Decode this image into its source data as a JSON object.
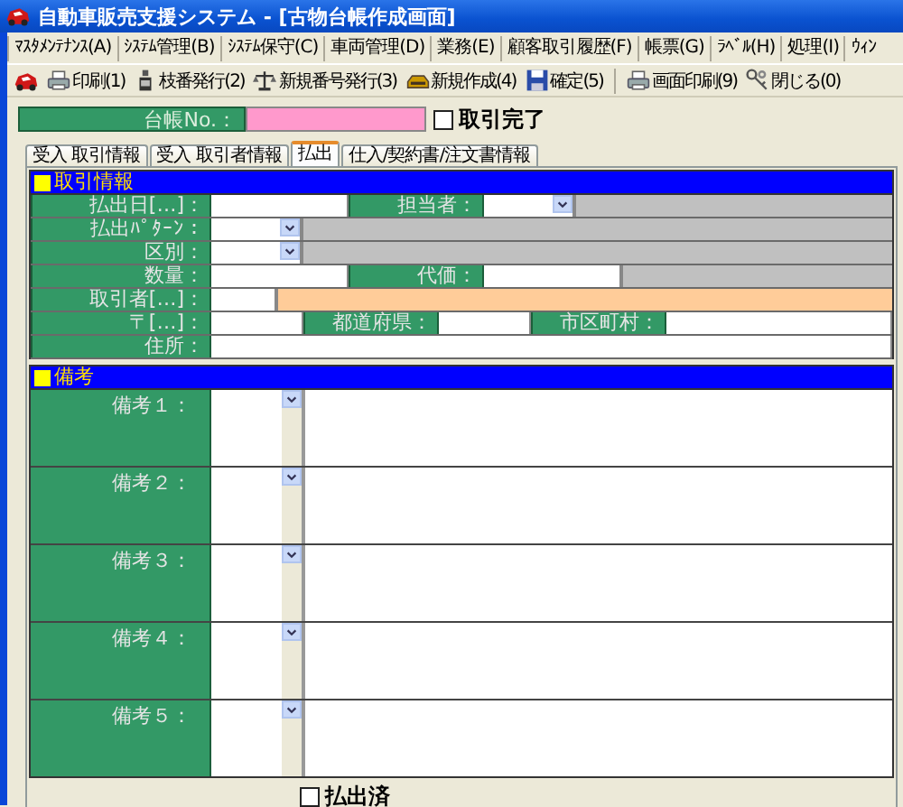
{
  "window": {
    "title": "自動車販売支援システム - [古物台帳作成画面]"
  },
  "menu": [
    "ﾏｽﾀﾒﾝﾃﾅﾝｽ(A)",
    "ｼｽﾃﾑ管理(B)",
    "ｼｽﾃﾑ保守(C)",
    "車両管理(D)",
    "業務(E)",
    "顧客取引履歴(F)",
    "帳票(G)",
    "ﾗﾍﾞﾙ(H)",
    "処理(I)",
    "ｳｨﾝ"
  ],
  "toolbar": [
    {
      "kind": "logo"
    },
    {
      "kind": "print",
      "label": "印刷(1)"
    },
    {
      "kind": "branch",
      "label": "枝番発行(2)"
    },
    {
      "kind": "scale",
      "label": "新規番号発行(3)"
    },
    {
      "kind": "tray",
      "label": "新規作成(4)"
    },
    {
      "kind": "save",
      "label": "確定(5)"
    },
    {
      "kind": "separator"
    },
    {
      "kind": "print",
      "label": "画面印刷(9)"
    },
    {
      "kind": "keys",
      "label": "閉じる(0)"
    }
  ],
  "ledger": {
    "label": "台帳No.：",
    "completed": {
      "label": "取引完了",
      "checked": false
    }
  },
  "tabs": [
    {
      "label": "受入 取引情報",
      "selected": false
    },
    {
      "label": "受入 取引者情報",
      "selected": false
    },
    {
      "label": "払出",
      "selected": true
    },
    {
      "label": "仕入/契約書/注文書情報",
      "selected": false
    }
  ],
  "transaction": {
    "title": "取引情報",
    "rows": [
      [
        {
          "kind": "label",
          "text": "払出日[…]："
        },
        {
          "kind": "text"
        },
        {
          "kind": "label2",
          "text": "担当者："
        },
        {
          "kind": "select"
        },
        {
          "kind": "filler",
          "color": "#c0c0c0"
        }
      ],
      [
        {
          "kind": "label",
          "text": "払出ﾊﾟﾀｰﾝ："
        },
        {
          "kind": "select"
        },
        {
          "kind": "filler",
          "color": "#c0c0c0"
        }
      ],
      [
        {
          "kind": "label",
          "text": "区別："
        },
        {
          "kind": "select"
        },
        {
          "kind": "filler",
          "color": "#c0c0c0"
        }
      ],
      [
        {
          "kind": "label",
          "text": "数量："
        },
        {
          "kind": "text"
        },
        {
          "kind": "label2",
          "text": "代価："
        },
        {
          "kind": "text"
        },
        {
          "kind": "filler",
          "color": "#c0c0c0"
        }
      ],
      [
        {
          "kind": "label",
          "text": "取引者[…]："
        },
        {
          "kind": "short"
        },
        {
          "kind": "filler",
          "color": "#ffcc99"
        }
      ],
      [
        {
          "kind": "label",
          "text": "〒[…]："
        },
        {
          "kind": "mid"
        },
        {
          "kind": "label2",
          "text": "都道府県："
        },
        {
          "kind": "mid"
        },
        {
          "kind": "label2",
          "text": "市区町村："
        },
        {
          "kind": "wide"
        }
      ],
      [
        {
          "kind": "label",
          "text": "住所："
        },
        {
          "kind": "wide"
        }
      ]
    ]
  },
  "remarks": {
    "title": "備考",
    "rows": [
      {
        "label": "備考１："
      },
      {
        "label": "備考２："
      },
      {
        "label": "備考３："
      },
      {
        "label": "備考４："
      },
      {
        "label": "備考５："
      }
    ]
  },
  "paid_out": {
    "label": "払出済",
    "checked": false
  }
}
